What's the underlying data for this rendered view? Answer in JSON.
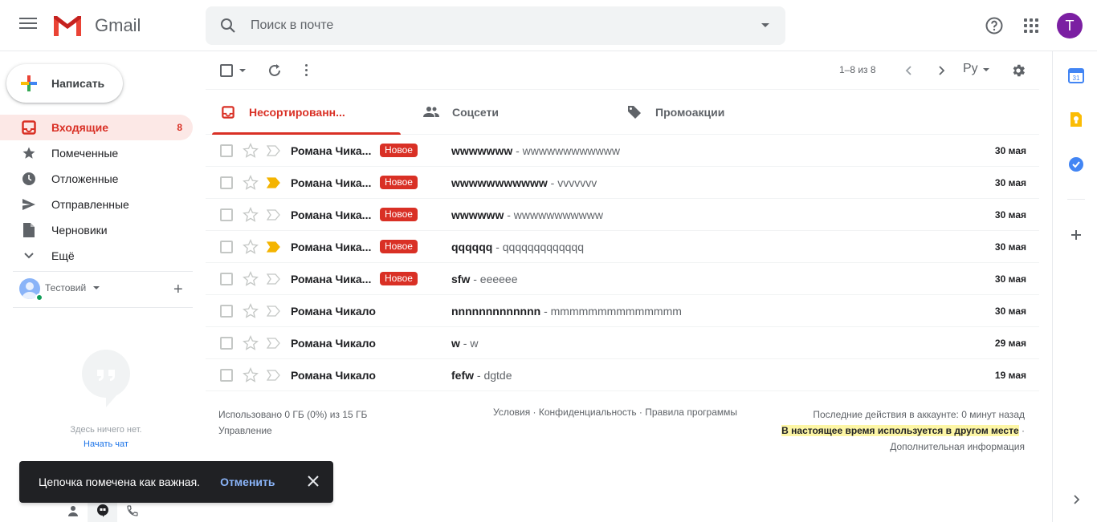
{
  "header": {
    "logo_text": "Gmail",
    "search_placeholder": "Поиск в почте",
    "avatar_letter": "Т"
  },
  "sidebar": {
    "compose_label": "Написать",
    "items": [
      {
        "label": "Входящие",
        "count": "8",
        "icon": "inbox-icon",
        "active": true
      },
      {
        "label": "Помеченные",
        "count": "",
        "icon": "star-icon",
        "active": false
      },
      {
        "label": "Отложенные",
        "count": "",
        "icon": "clock-icon",
        "active": false
      },
      {
        "label": "Отправленные",
        "count": "",
        "icon": "send-icon",
        "active": false
      },
      {
        "label": "Черновики",
        "count": "",
        "icon": "draft-icon",
        "active": false
      },
      {
        "label": "Ещё",
        "count": "",
        "icon": "chevron-down-icon",
        "active": false
      }
    ],
    "hangouts": {
      "user_name": "Тестовий",
      "empty_text": "Здесь ничего нет.",
      "start_chat": "Начать чат"
    }
  },
  "toolbar": {
    "pager": "1–8 из 8",
    "lang": "Ру"
  },
  "tabs": [
    {
      "label": "Несортированн...",
      "icon": "inbox-icon",
      "active": true
    },
    {
      "label": "Соцсети",
      "icon": "people-icon",
      "active": false
    },
    {
      "label": "Промоакции",
      "icon": "tag-icon",
      "active": false
    }
  ],
  "emails": [
    {
      "sender": "Романа Чика...",
      "badge": "Новое",
      "subject": "wwwwwww",
      "snippet": " - wwwwwwwwwwww",
      "date": "30 мая",
      "important": false
    },
    {
      "sender": "Романа Чика...",
      "badge": "Новое",
      "subject": "wwwwwwwwwww",
      "snippet": " - vvvvvvv",
      "date": "30 мая",
      "important": true
    },
    {
      "sender": "Романа Чика...",
      "badge": "Новое",
      "subject": "wwwwww",
      "snippet": " - wwwwwwwwwww",
      "date": "30 мая",
      "important": false
    },
    {
      "sender": "Романа Чика...",
      "badge": "Новое",
      "subject": "qqqqqq",
      "snippet": " - qqqqqqqqqqqqq",
      "date": "30 мая",
      "important": true
    },
    {
      "sender": "Романа Чика...",
      "badge": "Новое",
      "subject": "sfw",
      "snippet": " - eeeeee",
      "date": "30 мая",
      "important": false
    },
    {
      "sender": "Романа Чикало",
      "badge": "",
      "subject": "nnnnnnnnnnnnn",
      "snippet": " - mmmmmmmmmmmmmm",
      "date": "30 мая",
      "important": false
    },
    {
      "sender": "Романа Чикало",
      "badge": "",
      "subject": "w",
      "snippet": " - w",
      "date": "29 мая",
      "important": false
    },
    {
      "sender": "Романа Чикало",
      "badge": "",
      "subject": "fefw",
      "snippet": " - dgtde",
      "date": "19 мая",
      "important": false
    }
  ],
  "footer": {
    "storage": "Использовано 0 ГБ (0%) из 15 ГБ",
    "manage": "Управление",
    "links": "Условия · Конфиденциальность · Правила программы",
    "last_activity": "Последние действия в аккаунте: 0 минут назад",
    "other_place": "В настоящее время используется в другом месте",
    "other_place_sep": " ·",
    "details": "Дополнительная информация"
  },
  "toast": {
    "text": "Цепочка помечена как важная.",
    "undo": "Отменить"
  },
  "colors": {
    "accent_red": "#d93025",
    "important_yellow": "#f4b400",
    "avatar": "#7b1fa2"
  }
}
